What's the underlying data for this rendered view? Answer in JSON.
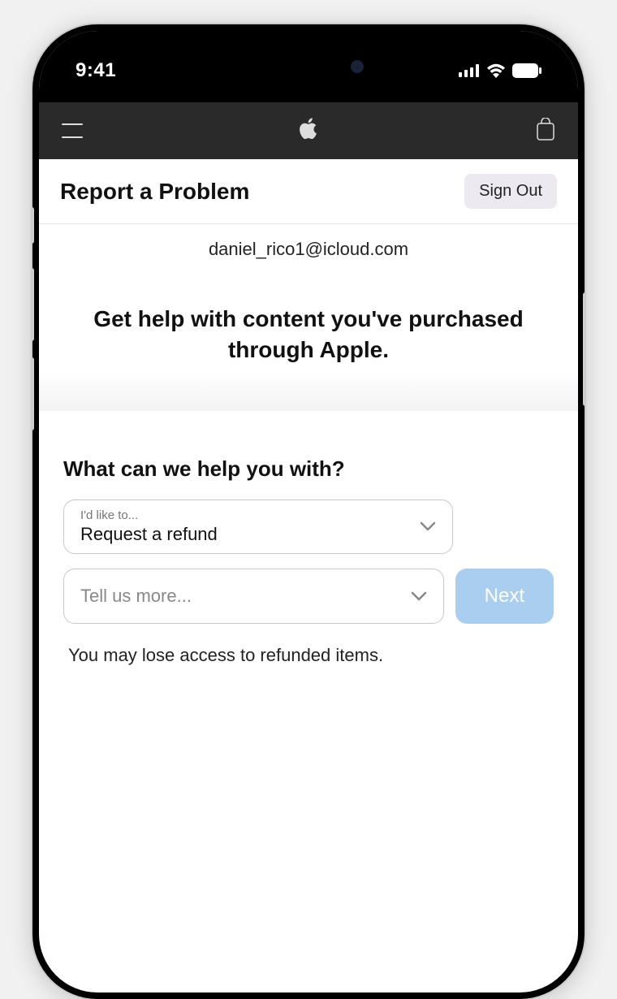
{
  "status": {
    "time": "9:41"
  },
  "header": {
    "title": "Report a Problem",
    "sign_out_label": "Sign Out",
    "email": "daniel_rico1@icloud.com"
  },
  "banner": {
    "heading": "Get help with content you've purchased through Apple."
  },
  "form": {
    "heading": "What can we help you with?",
    "select1_label": "I'd like to...",
    "select1_value": "Request a refund",
    "select2_placeholder": "Tell us more...",
    "next_label": "Next",
    "disclaimer": "You may lose access to refunded items."
  }
}
